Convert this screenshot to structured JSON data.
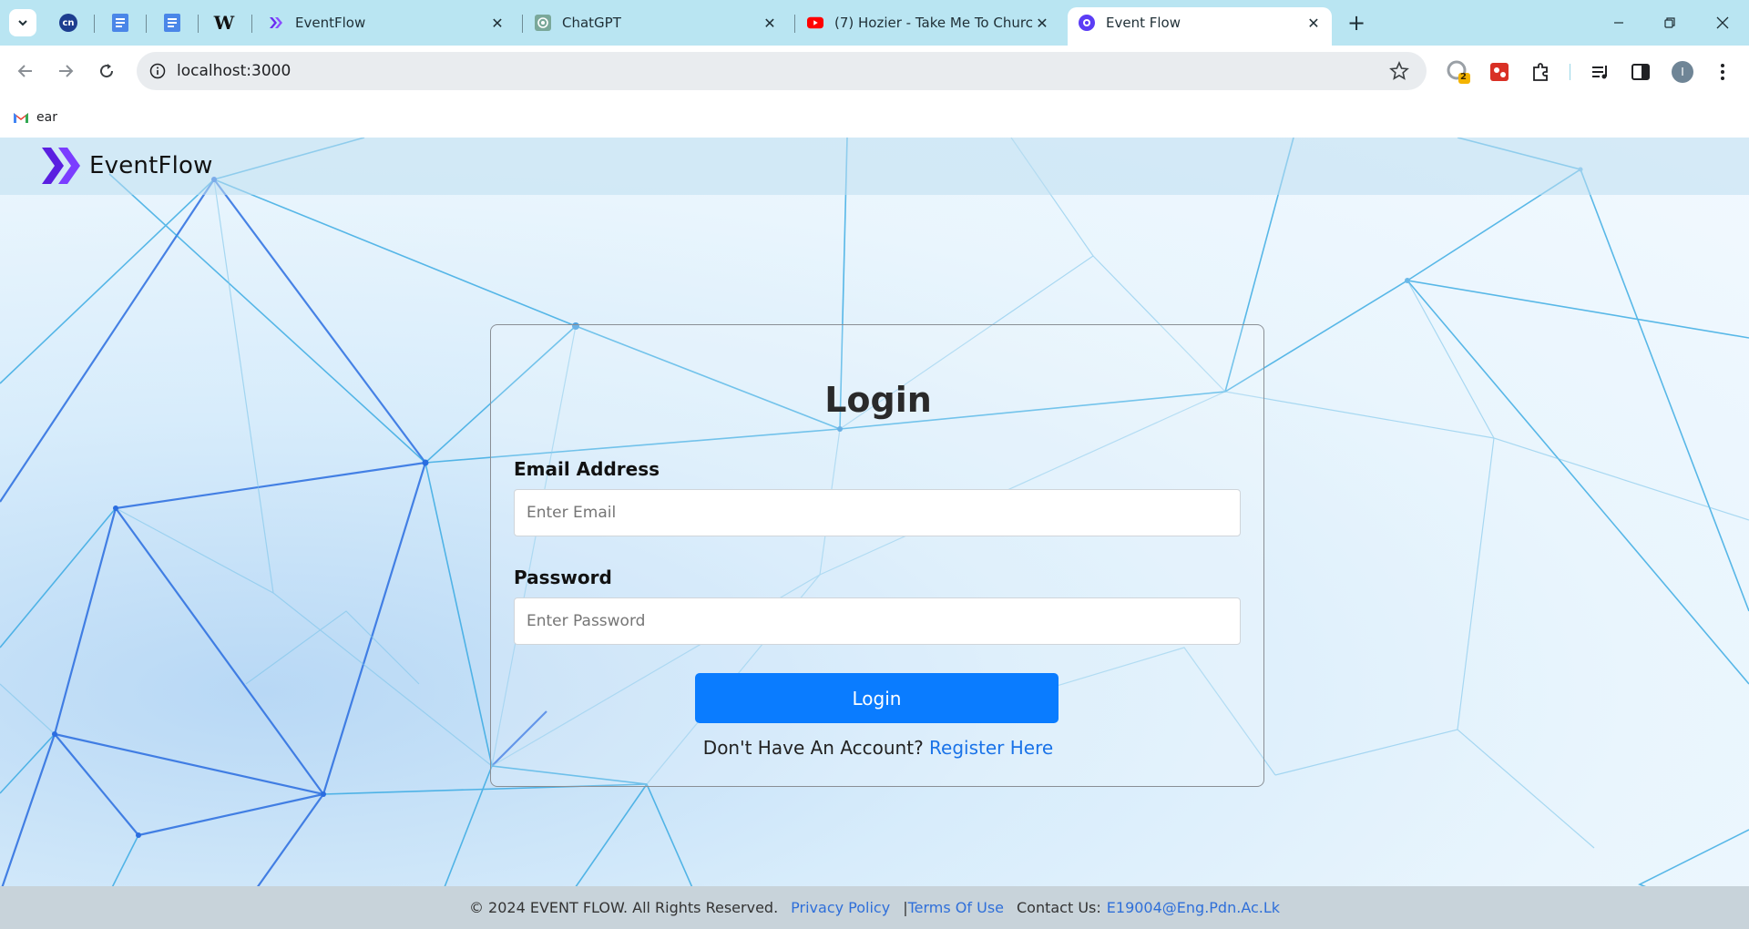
{
  "browser": {
    "tabs": [
      {
        "title": "EventFlow",
        "favicon": "eventflow-icon",
        "active": false
      },
      {
        "title": "ChatGPT",
        "favicon": "chatgpt-icon",
        "active": false
      },
      {
        "title": "(7) Hozier - Take Me To Church",
        "favicon": "youtube-icon",
        "active": false
      },
      {
        "title": "Event Flow",
        "favicon": "event-flow-icon",
        "active": true
      }
    ],
    "pinned_tabs": [
      "cn-icon",
      "docs-icon",
      "docs-icon",
      "wikipedia-icon"
    ],
    "wikipedia_glyph": "W",
    "cn_glyph": "cn",
    "close_glyph": "✕",
    "new_tab_glyph": "+",
    "url": "localhost:3000",
    "extension_badge": "2",
    "profile_initial": "I",
    "bookmarks": [
      {
        "label": "ear",
        "icon": "gmail-icon"
      }
    ]
  },
  "page": {
    "brand_name": "EventFlow",
    "login": {
      "title": "Login",
      "email_label": "Email Address",
      "email_placeholder": "Enter Email",
      "password_label": "Password",
      "password_placeholder": "Enter Password",
      "button_label": "Login",
      "no_account_text": "Don't Have An Account?",
      "register_link": "Register Here"
    },
    "footer": {
      "copyright": "© 2024 EVENT FLOW. All Rights Reserved.",
      "privacy": "Privacy Policy",
      "separator": "|",
      "terms": "Terms Of Use",
      "contact_label": "Contact Us:",
      "contact_email": "E19004@Eng.Pdn.Ac.Lk"
    }
  },
  "colors": {
    "tab_strip": "#b9e5f2",
    "primary_button": "#0a7cff",
    "link": "#1a73e8",
    "brand_purple": "#6a2cf0"
  }
}
